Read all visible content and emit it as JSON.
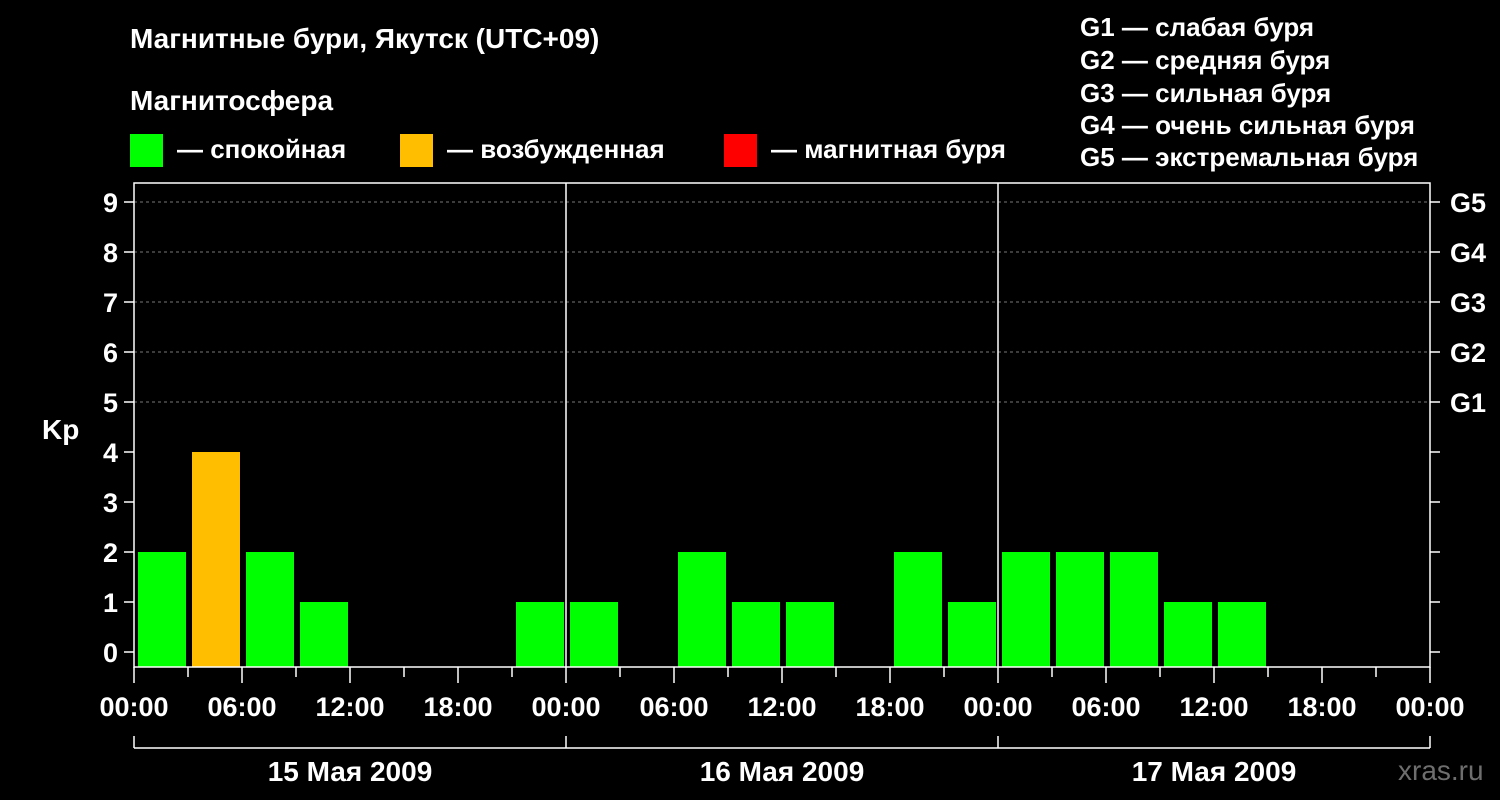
{
  "header": {
    "title": "Магнитные бури, Якутск (UTC+09)",
    "magnetosphere_label": "Магнитосфера"
  },
  "legend": [
    {
      "label": "— спокойная",
      "color": "#00ff00"
    },
    {
      "label": "— возбужденная",
      "color": "#ffbf00"
    },
    {
      "label": "— магнитная буря",
      "color": "#ff0000"
    }
  ],
  "storm_scale": [
    "G1 — слабая буря",
    "G2 — средняя буря",
    "G3 — сильная буря",
    "G4 — очень сильная буря",
    "G5 — экстремальная буря"
  ],
  "watermark": "xras.ru",
  "chart_data": {
    "type": "bar",
    "ylabel": "Kp",
    "ylim": [
      0,
      9
    ],
    "y_ticks": [
      "0",
      "1",
      "2",
      "3",
      "4",
      "5",
      "6",
      "7",
      "8",
      "9"
    ],
    "right_axis": [
      {
        "kp": 5,
        "label": "G1"
      },
      {
        "kp": 6,
        "label": "G2"
      },
      {
        "kp": 7,
        "label": "G3"
      },
      {
        "kp": 8,
        "label": "G4"
      },
      {
        "kp": 9,
        "label": "G5"
      }
    ],
    "x_ticks": [
      "00:00",
      "06:00",
      "12:00",
      "18:00",
      "00:00",
      "06:00",
      "12:00",
      "18:00",
      "00:00",
      "06:00",
      "12:00",
      "18:00",
      "00:00"
    ],
    "days": [
      "15 Мая 2009",
      "16 Мая 2009",
      "17 Мая 2009"
    ],
    "interval_hours": 3,
    "series": [
      {
        "values": [
          2,
          4,
          2,
          1,
          0,
          0,
          0,
          1,
          1,
          0,
          2,
          1,
          1,
          0,
          2,
          1,
          2,
          2,
          2,
          1,
          1,
          0,
          0,
          0
        ]
      }
    ],
    "level_colors": {
      "quiet": "#00ff00",
      "active": "#ffbf00",
      "storm": "#ff0000"
    },
    "grid": "dashed at Kp 5-9"
  }
}
